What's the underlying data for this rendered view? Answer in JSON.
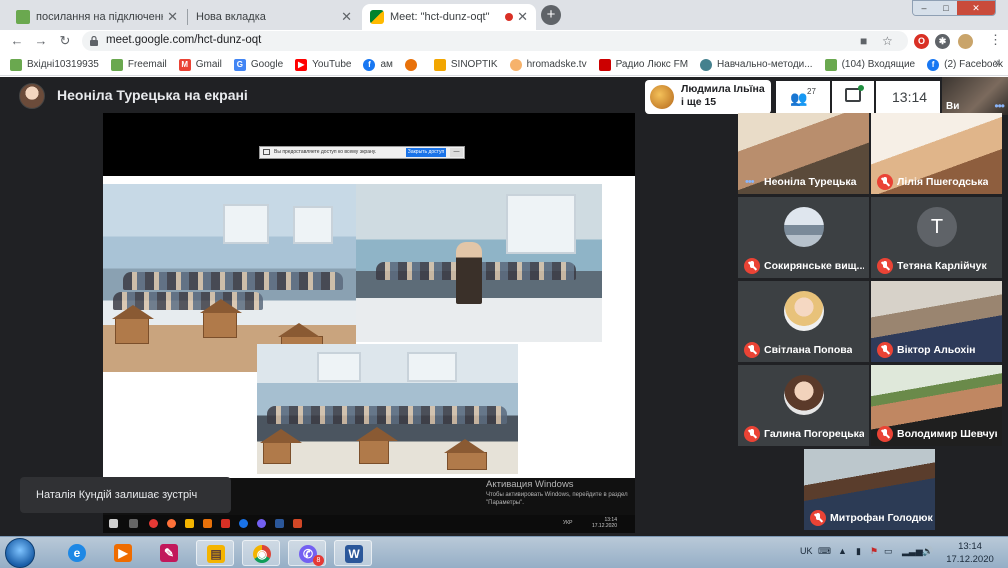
{
  "browser": {
    "tabs": [
      {
        "title": "посилання на підключення • пс"
      },
      {
        "title": "Нова вкладка"
      },
      {
        "title": "Meet: \"hct-dunz-oqt\""
      }
    ],
    "new_tab_symbol": "+",
    "window_controls": {
      "minimize": "–",
      "maximize": "□",
      "close": "✕"
    },
    "url": "meet.google.com/hct-dunz-oqt",
    "extension_label": "O",
    "bookmarks": [
      {
        "label": "Вхідні10319935",
        "icon": "mail-icon",
        "color": "#6aa84f"
      },
      {
        "label": "Freemail",
        "icon": "mail-icon",
        "color": "#6aa84f"
      },
      {
        "label": "Gmail",
        "icon": "gmail-icon",
        "color": "#ea4335"
      },
      {
        "label": "Google",
        "icon": "google-icon",
        "color": "#4285f4"
      },
      {
        "label": "YouTube",
        "icon": "youtube-icon",
        "color": "#ff0000"
      },
      {
        "label": "ам",
        "icon": "facebook-icon",
        "color": "#1877f2"
      },
      {
        "label": "",
        "icon": "orange-circle-icon",
        "color": "#e8710a"
      },
      {
        "label": "SINOPTIK",
        "icon": "weather-icon",
        "color": "#f2a600"
      },
      {
        "label": "hromadske.tv",
        "icon": "hromadske-icon",
        "color": "#f6b26b"
      },
      {
        "label": "Радио Люкс FM",
        "icon": "radio-icon",
        "color": "#cc0000"
      },
      {
        "label": "Навчально-методи...",
        "icon": "globe-icon",
        "color": "#45818e"
      },
      {
        "label": "(104) Входящие",
        "icon": "mail-icon",
        "color": "#6aa84f"
      },
      {
        "label": "(2) Facebook",
        "icon": "facebook-icon",
        "color": "#1877f2"
      }
    ]
  },
  "meet": {
    "presenter_title": "Неоніла Турецька на екрані",
    "companion_name": "Людмила Ільїна\nі ще 15",
    "participants_count": "27",
    "time": "13:14",
    "self_label": "Ви",
    "share_bar": {
      "text": "Вы предоставляете доступ ко всему экрану.",
      "stop_label": "Закрыть доступ",
      "hide_label": "Скрыть"
    },
    "activation": {
      "title": "Активация Windows",
      "subtitle": "Чтобы активировать Windows, перейдите в раздел \"Параметры\"."
    },
    "inner_taskbar": {
      "lang": "УКР",
      "time": "13:14",
      "date": "17.12.2020"
    },
    "toast": "Наталія Кундій залишає зустріч",
    "tiles": [
      {
        "name": "Неоніла Турецька",
        "muted": false
      },
      {
        "name": "Лілія Пшегодська",
        "muted": true
      },
      {
        "name": "Сокирянське вищ...",
        "muted": true
      },
      {
        "name": "Тетяна Карлійчук",
        "muted": true,
        "initial": "Т"
      },
      {
        "name": "Світлана Попова",
        "muted": true
      },
      {
        "name": "Віктор Альохін",
        "muted": true
      },
      {
        "name": "Галина Погорецька",
        "muted": true
      },
      {
        "name": "Володимир Шевчук",
        "muted": true
      },
      {
        "name": "Митрофан Голодюк",
        "muted": true
      }
    ]
  },
  "taskbar": {
    "apps": [
      {
        "name": "internet-explorer",
        "glyph": "e"
      },
      {
        "name": "media-player",
        "glyph": "▶"
      },
      {
        "name": "paint",
        "glyph": "✎"
      },
      {
        "name": "file-explorer",
        "glyph": "▤"
      },
      {
        "name": "chrome",
        "glyph": "◉"
      },
      {
        "name": "viber",
        "glyph": "✆",
        "badge": "8"
      },
      {
        "name": "word",
        "glyph": "W"
      }
    ],
    "lang": "UK",
    "time": "13:14",
    "date": "17.12.2020"
  }
}
